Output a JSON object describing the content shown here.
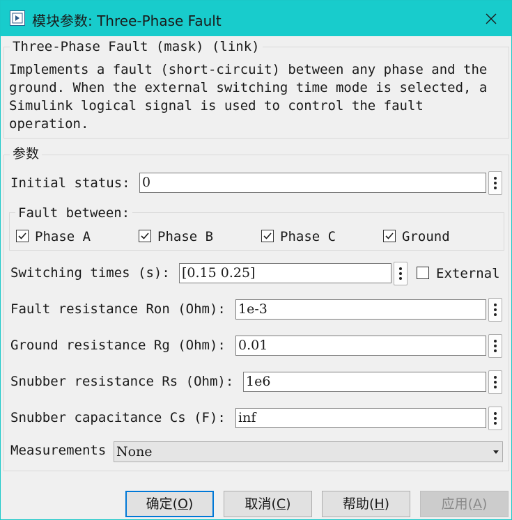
{
  "window": {
    "title": "模块参数: Three-Phase Fault",
    "close_icon": "close-icon"
  },
  "description_group": {
    "legend": "Three-Phase Fault (mask) (link)",
    "text": "Implements a fault (short-circuit) between any phase and the\nground. When the external switching time mode is selected, a\nSimulink logical signal is used to control the fault\noperation."
  },
  "parameters": {
    "legend": "参数",
    "initial_status": {
      "label": "Initial status:",
      "value": "0"
    },
    "fault_between": {
      "legend": "Fault between:",
      "phase_a": {
        "label": "Phase A",
        "checked": true
      },
      "phase_b": {
        "label": "Phase B",
        "checked": true
      },
      "phase_c": {
        "label": "Phase C",
        "checked": true
      },
      "ground": {
        "label": "Ground",
        "checked": true
      }
    },
    "switching_times": {
      "label": "Switching times (s):",
      "value": "[0.15  0.25]"
    },
    "external": {
      "label": "External",
      "checked": false
    },
    "fault_resistance": {
      "label": "Fault resistance Ron (Ohm):",
      "value": "1e-3"
    },
    "ground_resistance": {
      "label": "Ground resistance Rg (Ohm):",
      "value": "0.01"
    },
    "snubber_resistance": {
      "label": "Snubber resistance Rs (Ohm):",
      "value": "1e6"
    },
    "snubber_capacitance": {
      "label": "Snubber capacitance Cs (F):",
      "value": "inf"
    },
    "measurements": {
      "label": "Measurements",
      "value": "None"
    }
  },
  "buttons": {
    "ok": {
      "text": "确定",
      "mnemonic": "O"
    },
    "cancel": {
      "text": "取消",
      "mnemonic": "C"
    },
    "help": {
      "text": "帮助",
      "mnemonic": "H"
    },
    "apply": {
      "text": "应用",
      "mnemonic": "A",
      "disabled": true
    }
  },
  "colors": {
    "titlebar": "#18cccc",
    "background": "#f0f0f0",
    "focus_border": "#0078d7"
  }
}
